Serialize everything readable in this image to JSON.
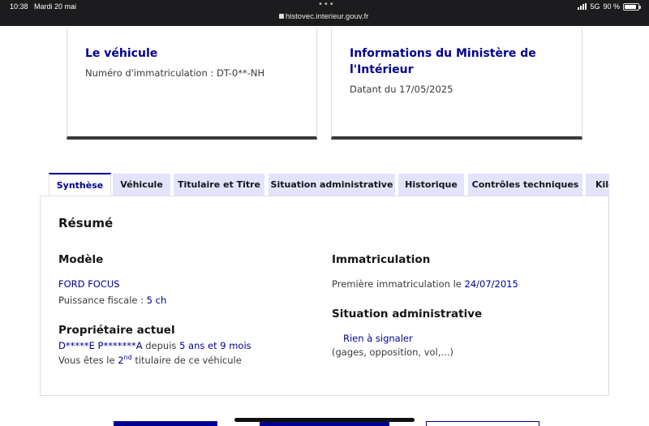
{
  "status_bar": {
    "time": "10:38",
    "date": "Mardi 20 mai",
    "url": "histovec.interieur.gouv.fr",
    "network": "5G",
    "battery": "90 %",
    "battery_level": 0.9
  },
  "vehicle_card": {
    "title": "Le véhicule",
    "registration": "Numéro d'immatriculation : DT-0**-NH"
  },
  "ministry_card": {
    "title_line1": "Informations du Ministère de",
    "title_line2": "l'Intérieur",
    "dated": "Datant du 17/05/2025"
  },
  "tabs": [
    {
      "label": "Synthèse",
      "active": true
    },
    {
      "label": "Véhicule",
      "active": false
    },
    {
      "label": "Titulaire et Titre",
      "active": false
    },
    {
      "label": "Situation administrative",
      "active": false
    },
    {
      "label": "Historique",
      "active": false
    },
    {
      "label": "Contrôles techniques",
      "active": false
    },
    {
      "label": "Kilo",
      "active": false
    }
  ],
  "summary": {
    "title": "Résumé",
    "model": {
      "heading": "Modèle",
      "name": "FORD FOCUS",
      "fiscal_label": "Puissance fiscale : ",
      "fiscal_value": "5 ch"
    },
    "owner": {
      "heading": "Propriétaire actuel",
      "name": "D*****E P*******A",
      "since_label": " depuis ",
      "since_value": "5 ans et 9 mois",
      "rank_prefix": "Vous êtes le ",
      "rank_number": "2",
      "rank_suffix": "nd",
      "rank_tail": " titulaire de ce véhicule"
    },
    "registration": {
      "heading": "Immatriculation",
      "first_label": "Première immatriculation le ",
      "first_date": "24/07/2015"
    },
    "admin": {
      "heading": "Situation administrative",
      "status": "Rien à signaler",
      "details": "(gages, opposition, vol,...)"
    }
  },
  "colors": {
    "primary": "#000091",
    "tab_bg": "#e3e3fd",
    "text": "#3a3a3a"
  }
}
